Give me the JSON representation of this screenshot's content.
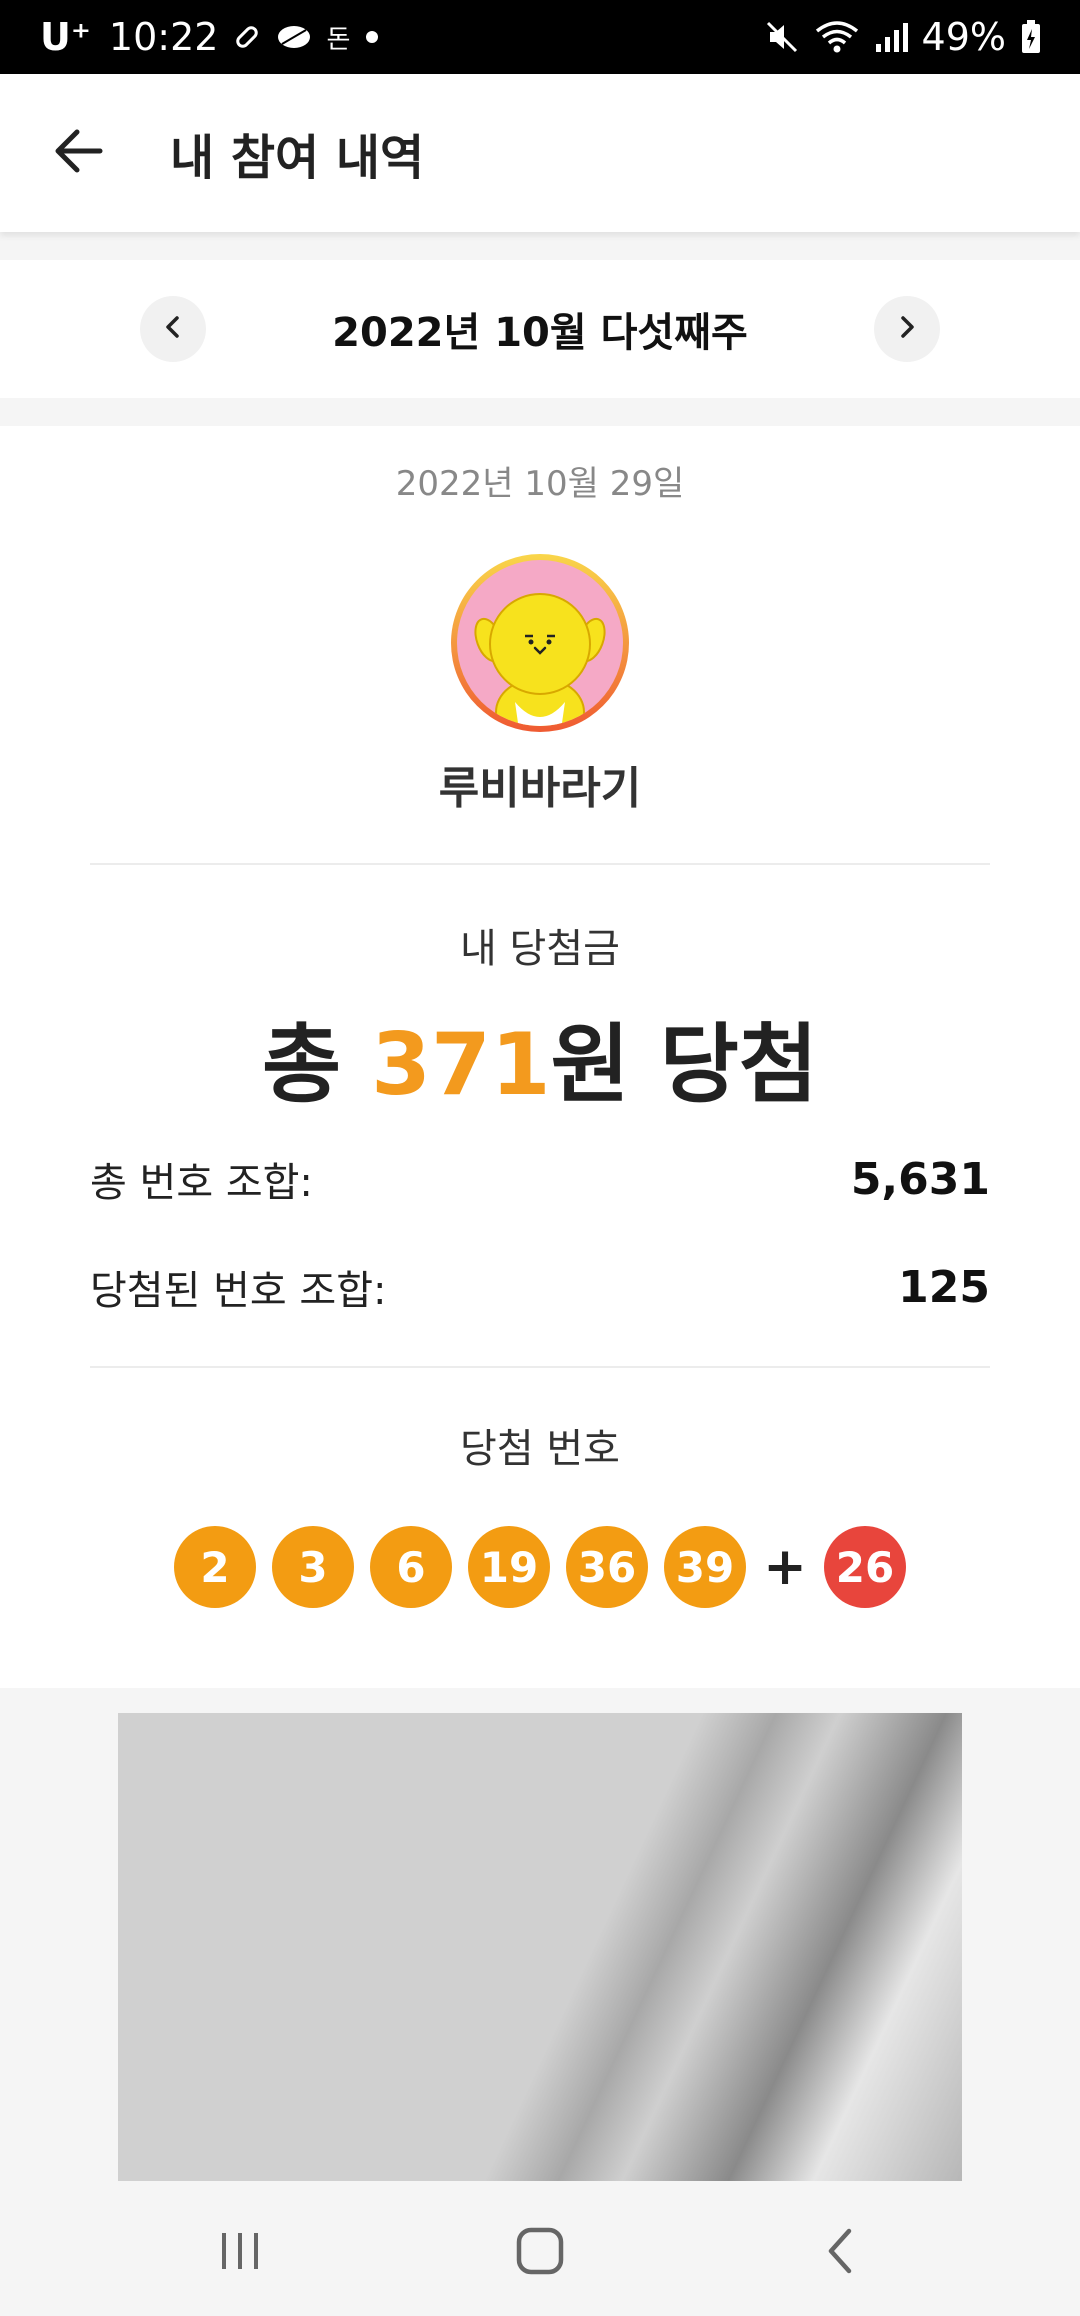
{
  "status_bar": {
    "carrier": "U⁺",
    "time": "10:22",
    "notif_text": "돈",
    "battery": "49%"
  },
  "header": {
    "title": "내 참여 내역"
  },
  "week": {
    "label": "2022년 10월 다섯째주"
  },
  "result": {
    "date": "2022년 10월 29일",
    "nickname": "루비바라기",
    "prize_label": "내 당첨금",
    "prize_prefix": "총 ",
    "prize_amount": "371",
    "prize_suffix": "원 당첨",
    "total_combos_label": "총 번호 조합:",
    "total_combos_value": "5,631",
    "winning_combos_label": "당첨된 번호 조합:",
    "winning_combos_value": "125",
    "winning_numbers_label": "당첨 번호",
    "numbers": [
      "2",
      "3",
      "6",
      "19",
      "36",
      "39"
    ],
    "plus": "+",
    "bonus": "26"
  },
  "colors": {
    "accent": "#f39a1e",
    "ball": "#f39c12",
    "bonus_ball": "#e8453c"
  },
  "icons": {
    "back": "arrow-left-icon",
    "prev": "chevron-left-icon",
    "next": "chevron-right-icon",
    "nav_recents": "recents-icon",
    "nav_home": "home-icon",
    "nav_back": "nav-back-icon"
  }
}
